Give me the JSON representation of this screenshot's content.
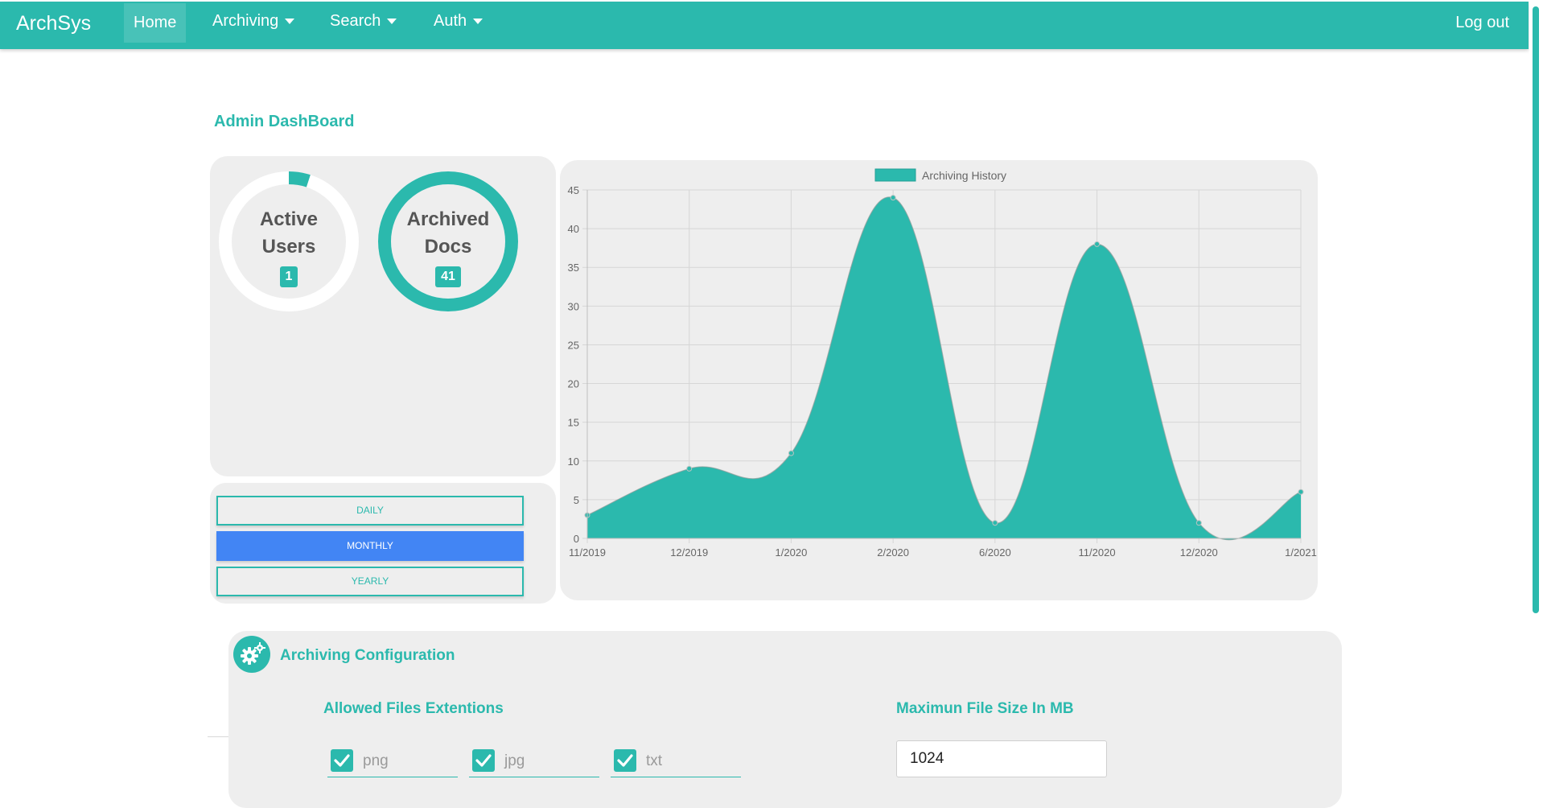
{
  "navbar": {
    "brand": "ArchSys",
    "items": [
      {
        "label": "Home",
        "active": true,
        "dropdown": false
      },
      {
        "label": "Archiving",
        "active": false,
        "dropdown": true
      },
      {
        "label": "Search",
        "active": false,
        "dropdown": true
      },
      {
        "label": "Auth",
        "active": false,
        "dropdown": true
      }
    ],
    "logout": "Log out"
  },
  "dashboard": {
    "title": "Admin DashBoard",
    "stats": [
      {
        "label_line1": "Active",
        "label_line2": "Users",
        "value": "1",
        "fill_fraction": 0.05
      },
      {
        "label_line1": "Archived",
        "label_line2": "Docs",
        "value": "41",
        "fill_fraction": 1.0
      }
    ],
    "period_buttons": [
      {
        "label": "DAILY",
        "selected": false
      },
      {
        "label": "MONTHLY",
        "selected": true
      },
      {
        "label": "YEARLY",
        "selected": false
      }
    ]
  },
  "chart_data": {
    "type": "area",
    "categories": [
      "11/2019",
      "12/2019",
      "1/2020",
      "2/2020",
      "6/2020",
      "11/2020",
      "12/2020",
      "1/2021"
    ],
    "series": [
      {
        "name": "Archiving History",
        "values": [
          3,
          9,
          11,
          44,
          2,
          38,
          2,
          6
        ]
      }
    ],
    "ylim": [
      0,
      45
    ],
    "yticks": [
      0,
      5,
      10,
      15,
      20,
      25,
      30,
      35,
      40,
      45
    ],
    "grid": true,
    "legend": "top-center",
    "color": "#2bb9ad"
  },
  "config": {
    "title": "Archiving Configuration",
    "extensions_title": "Allowed Files Extentions",
    "extensions": [
      {
        "label": "png",
        "checked": true
      },
      {
        "label": "jpg",
        "checked": true
      },
      {
        "label": "txt",
        "checked": true
      }
    ],
    "max_size_title": "Maximun File Size In MB",
    "max_size_value": "1024"
  },
  "colors": {
    "accent": "#2bb9ad",
    "selected": "#4285f4",
    "panel": "#eeeeee"
  }
}
